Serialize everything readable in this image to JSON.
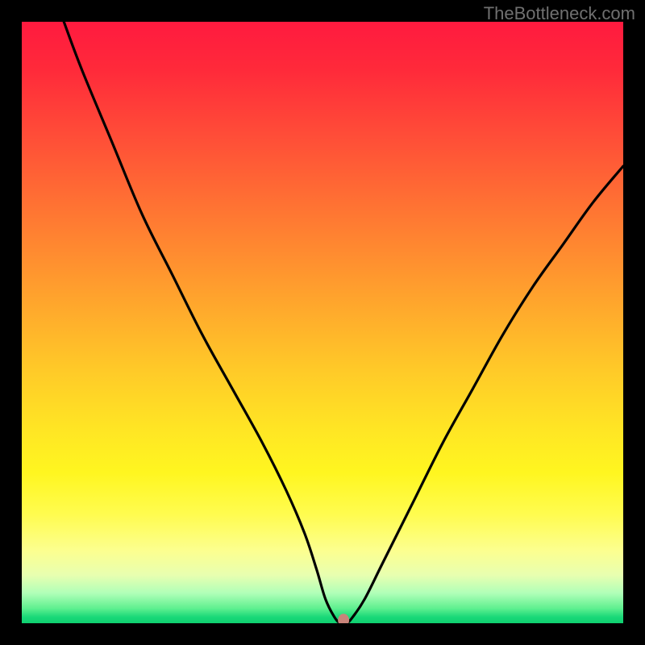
{
  "watermark": "TheBottleneck.com",
  "chart_data": {
    "type": "line",
    "title": "",
    "xlabel": "",
    "ylabel": "",
    "xlim": [
      0,
      100
    ],
    "ylim": [
      0,
      100
    ],
    "series": [
      {
        "name": "curve",
        "x": [
          7,
          10,
          15,
          20,
          25,
          30,
          35,
          40,
          44,
          47,
          49,
          50.5,
          52,
          53,
          54,
          55,
          57,
          60,
          65,
          70,
          75,
          80,
          85,
          90,
          95,
          100
        ],
        "y": [
          100,
          92,
          80,
          68,
          58,
          48,
          39,
          30,
          22,
          15,
          9,
          4,
          1,
          0,
          0,
          1,
          4,
          10,
          20,
          30,
          39,
          48,
          56,
          63,
          70,
          76
        ]
      }
    ],
    "marker": {
      "x": 53.5,
      "y": 0.5,
      "color": "#c9847a"
    },
    "gradient": {
      "top_color": "#ff1a3f",
      "bottom_color": "#10d070"
    }
  }
}
